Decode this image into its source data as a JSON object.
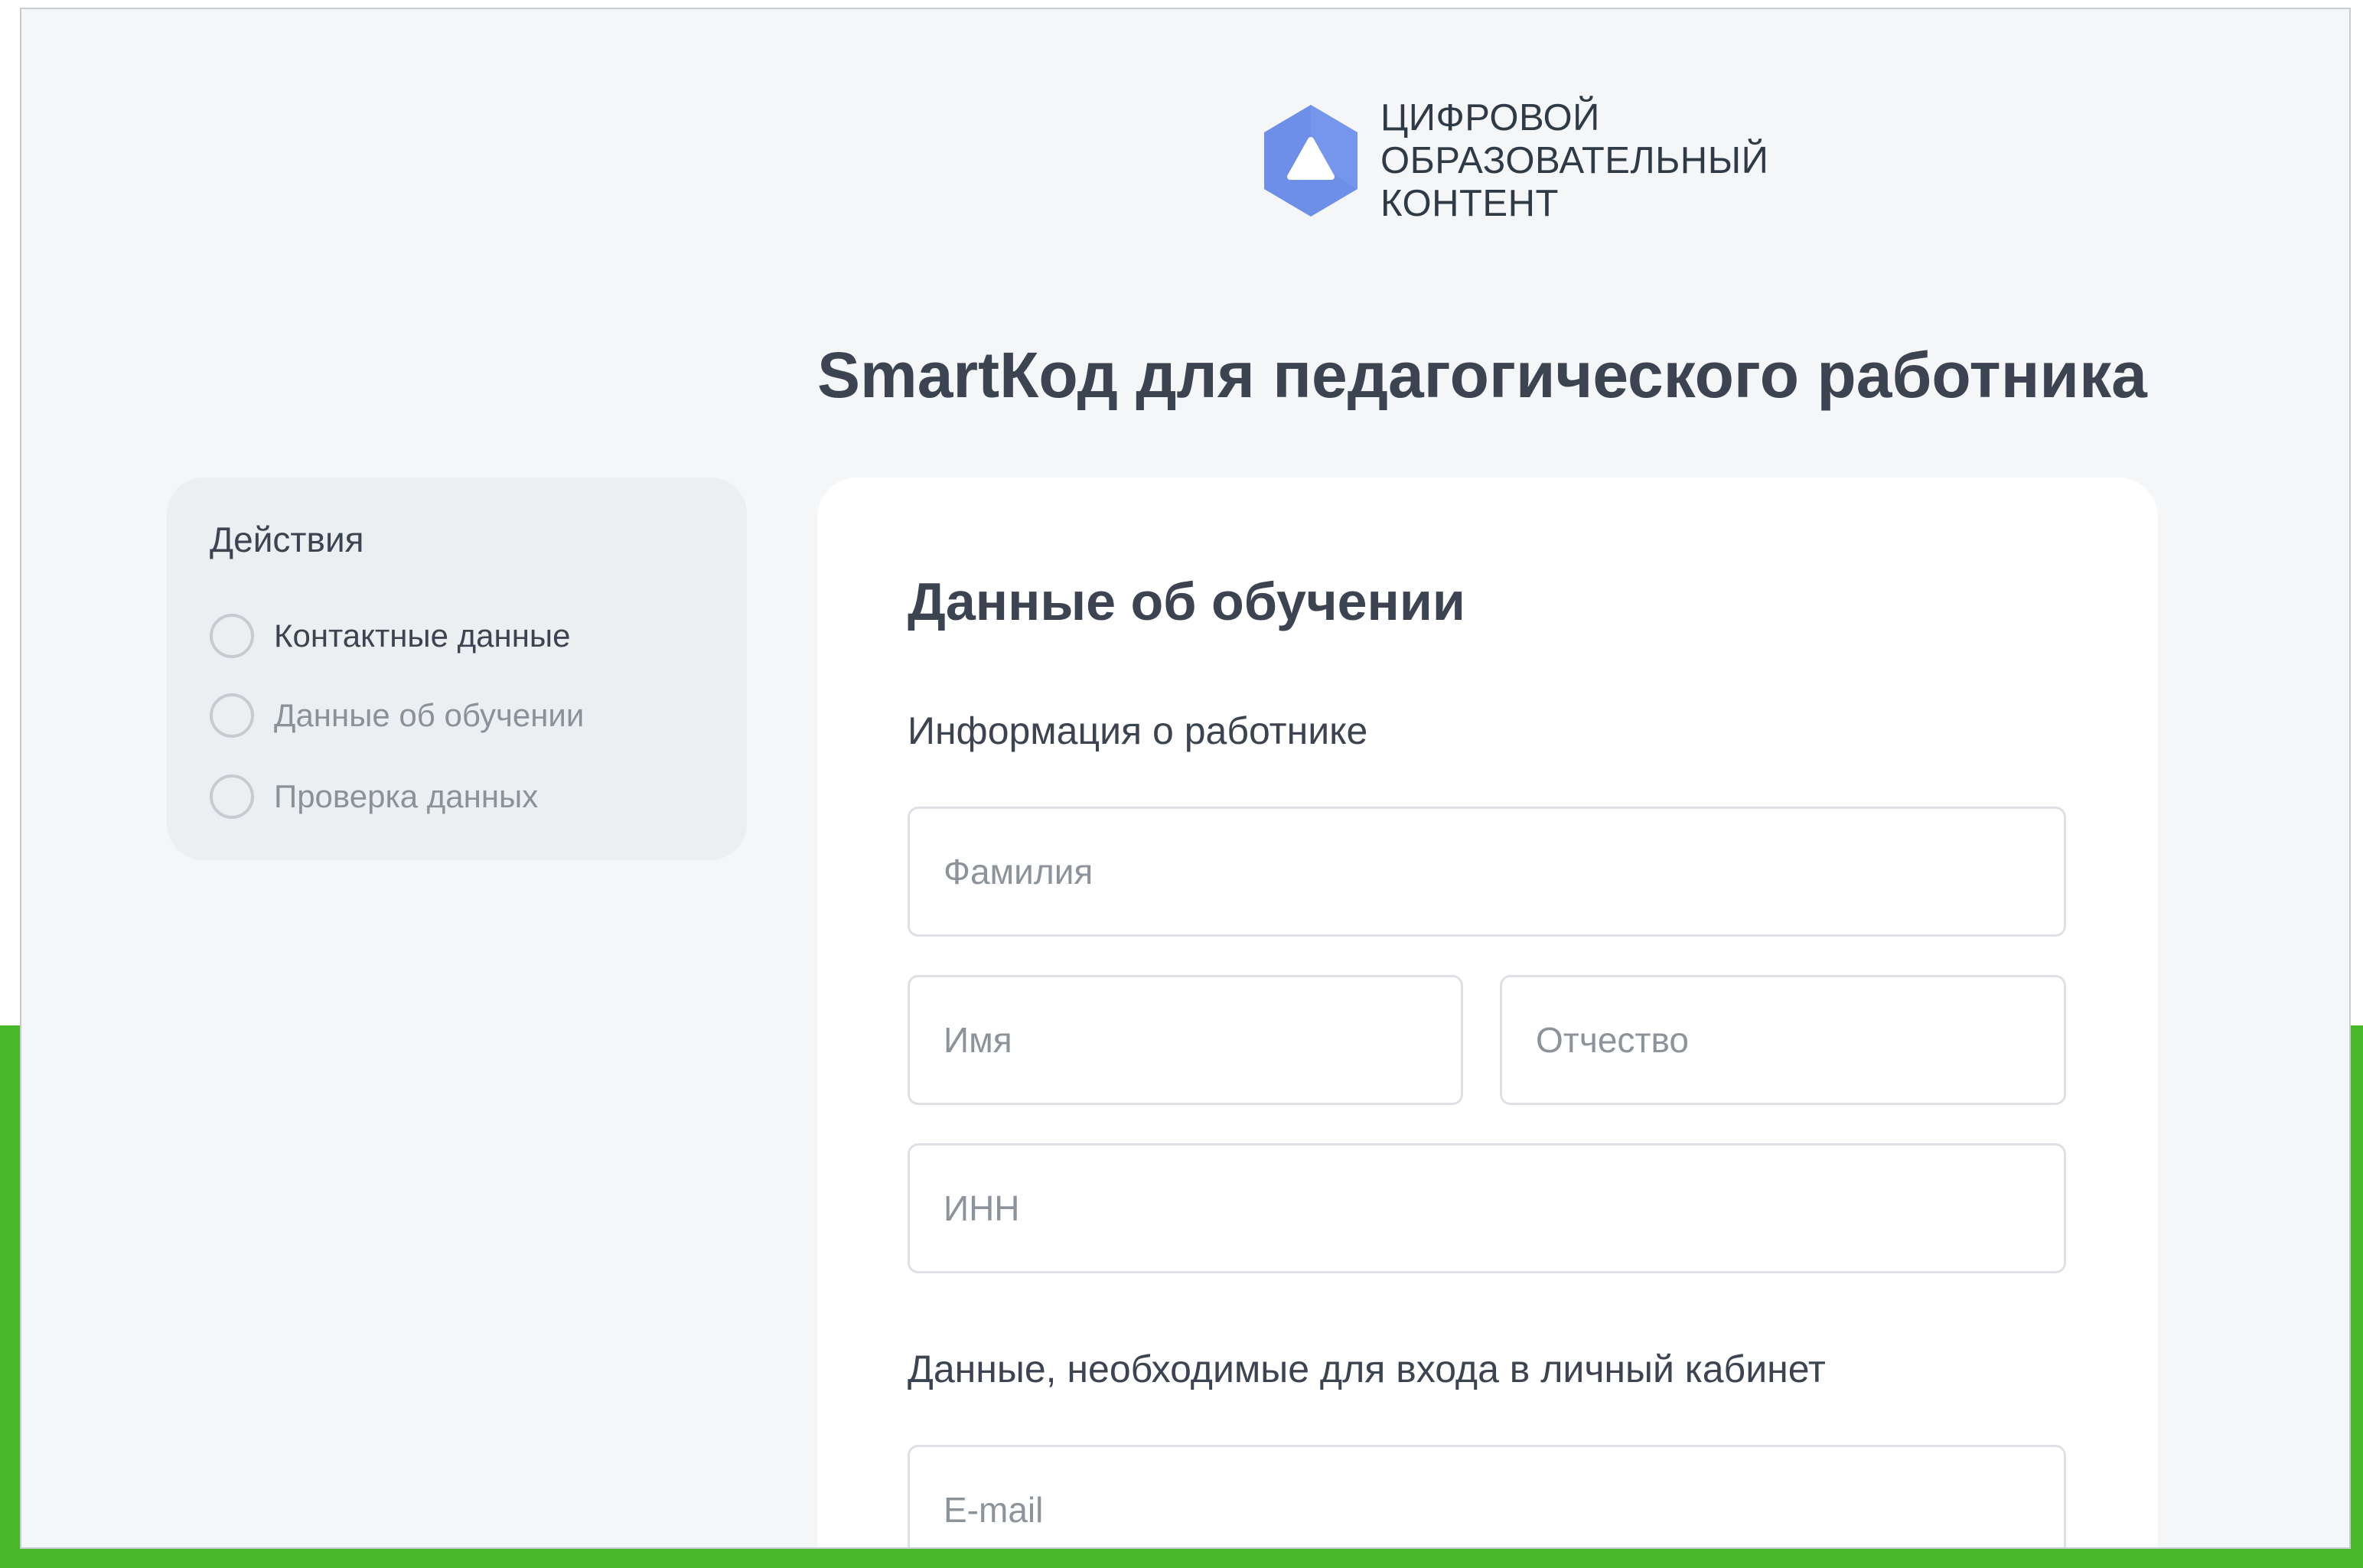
{
  "logo": {
    "icon": "hexagon-triangle-logo-icon",
    "color": "#6e8fe8",
    "lines": [
      "ЦИФРОВОЙ",
      "ОБРАЗОВАТЕЛЬНЫЙ",
      "КОНТЕНТ"
    ]
  },
  "page_title": "SmartКод для педагогического работника",
  "sidebar": {
    "title": "Действия",
    "steps": [
      {
        "label": "Контактные данные",
        "active": true
      },
      {
        "label": "Данные об обучении",
        "active": false
      },
      {
        "label": "Проверка данных",
        "active": false
      }
    ]
  },
  "form": {
    "title": "Данные об обучении",
    "worker_section": "Информация о работнике",
    "fields": {
      "surname_placeholder": "Фамилия",
      "name_placeholder": "Имя",
      "patronymic_placeholder": "Отчество",
      "inn_placeholder": "ИНН",
      "email_placeholder": "E-mail"
    },
    "login_section": "Данные, необходимые для входа в личный кабинет"
  },
  "colors": {
    "accent": "#6e8fe8",
    "background_band": "#48b82a",
    "text": "#3b4450"
  }
}
